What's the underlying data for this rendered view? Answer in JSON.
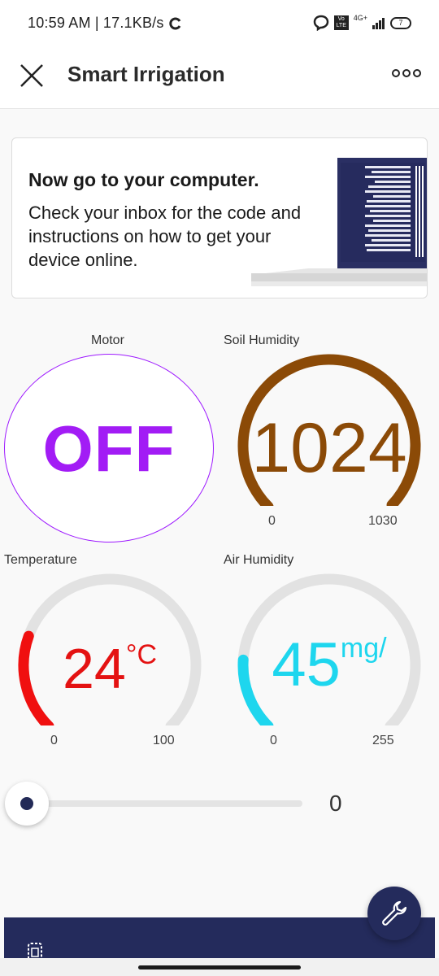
{
  "status_bar": {
    "time_speed": "10:59 AM | 17.1KB/s",
    "network": "4G+",
    "volte": "Vo LTE",
    "battery": "7"
  },
  "app_bar": {
    "title": "Smart Irrigation"
  },
  "promo": {
    "heading": "Now go to your computer.",
    "body": "Check your inbox for the code and instructions on how to get your device online."
  },
  "motor": {
    "label": "Motor",
    "state": "OFF",
    "color": "#a21cf5"
  },
  "soil_humidity": {
    "label": "Soil Humidity",
    "value": "1024",
    "min": "0",
    "max": "1030",
    "fraction": 0.994,
    "color": "#8b4a07"
  },
  "temperature": {
    "label": "Temperature",
    "value": "24",
    "unit": "°C",
    "min": "0",
    "max": "100",
    "fraction": 0.24,
    "color": "#f01010"
  },
  "air_humidity": {
    "label": "Air Humidity",
    "value": "45",
    "unit": "mg/",
    "min": "0",
    "max": "255",
    "fraction": 0.18,
    "color": "#1ed6ee"
  },
  "slider": {
    "value": "0",
    "fraction": 0
  },
  "colors": {
    "accent": "#242b5c",
    "gauge_track": "#e2e2e2"
  }
}
